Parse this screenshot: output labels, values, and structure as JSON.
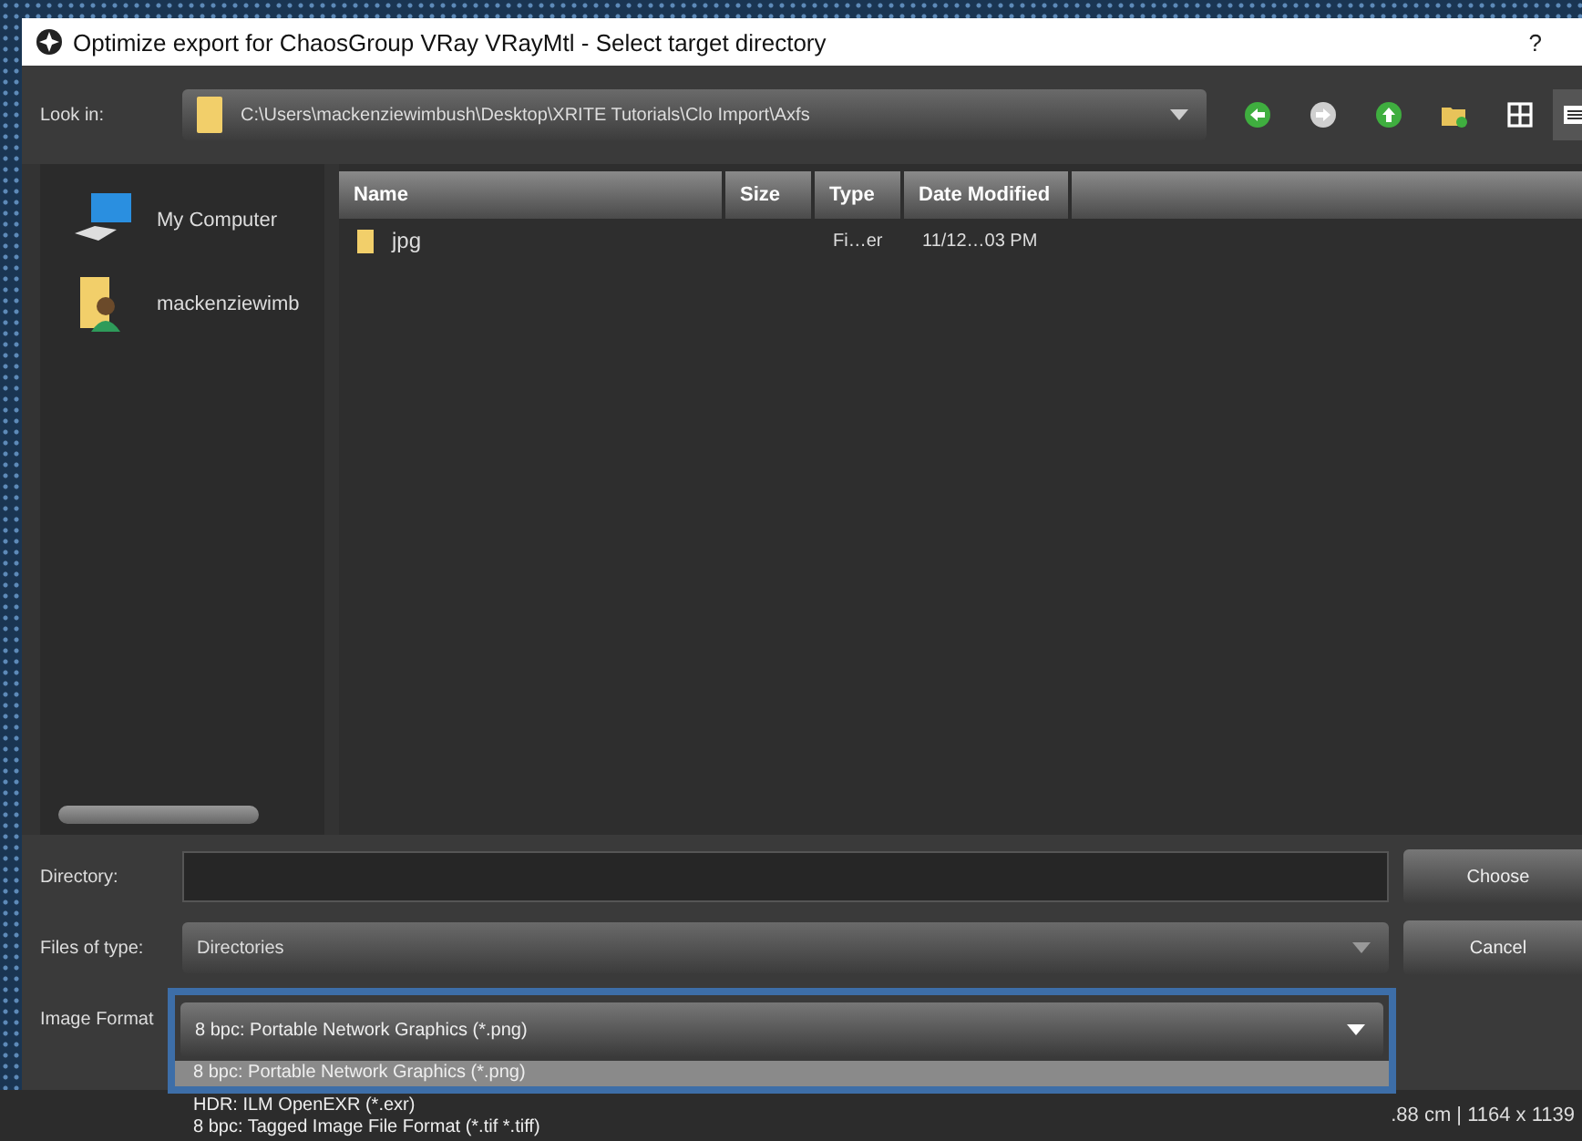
{
  "window": {
    "title": "Optimize export for ChaosGroup VRay VRayMtl - Select target directory"
  },
  "title_buttons": [
    {
      "label": "?",
      "kind": "help"
    }
  ],
  "look_in": {
    "label": "Look in:",
    "path": "C:\\Users\\mackenziewimbush\\Desktop\\XRITE Tutorials\\Clo Import\\Axfs"
  },
  "nav_buttons": [
    {
      "kind": "back"
    },
    {
      "kind": "forward"
    },
    {
      "kind": "up"
    },
    {
      "kind": "new-folder"
    },
    {
      "kind": "grid-view"
    },
    {
      "kind": "list-view"
    }
  ],
  "places": [
    {
      "label": "My Computer",
      "kind": "computer"
    },
    {
      "label": "mackenziewimb",
      "kind": "user"
    }
  ],
  "table": {
    "columns": [
      "Name",
      "Size",
      "Type",
      "Date Modified"
    ],
    "rows": [
      {
        "name": "jpg",
        "type": "Fi…er",
        "date": "11/12…03 PM"
      }
    ]
  },
  "directory": {
    "label": "Directory:"
  },
  "files_of_type": {
    "label": "Files of type:",
    "value": "Directories"
  },
  "image_format": {
    "label": "Image Format",
    "value": "8 bpc: Portable Network Graphics (*.png)"
  },
  "dropdown_options": [
    {
      "label": "8 bpc: Portable Network Graphics (*.png)",
      "selected": true
    },
    {
      "label": "HDR: ILM OpenEXR (*.exr)",
      "selected": false
    },
    {
      "label": "8 bpc: Tagged Image File Format (*.tif *.tiff)",
      "selected": false
    }
  ],
  "buttons": [
    "Choose",
    "Cancel"
  ],
  "status_text": ".88 cm | 1164 x 1139"
}
